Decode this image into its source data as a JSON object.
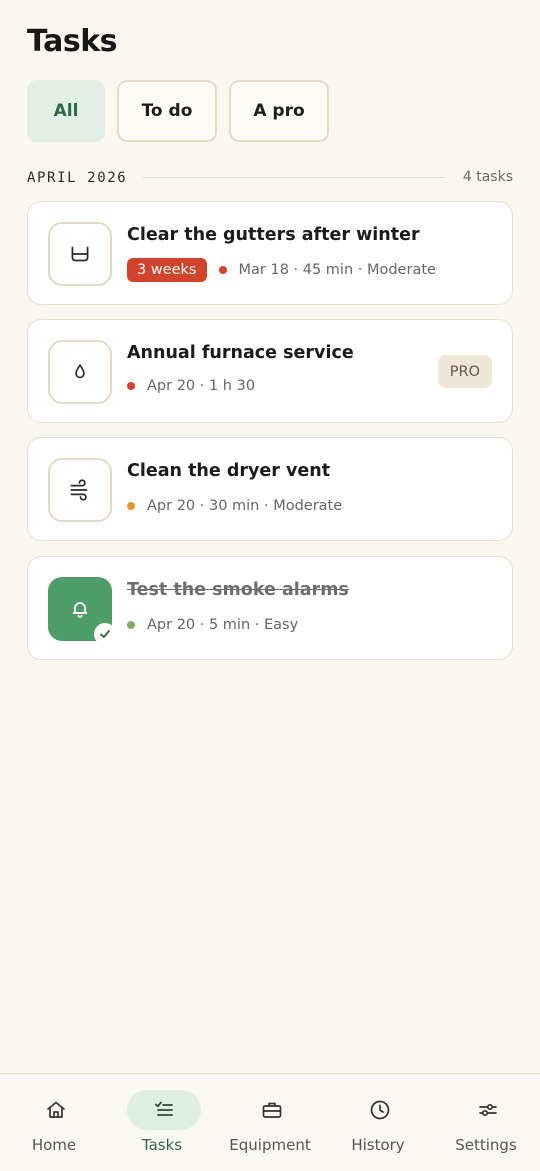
{
  "header": {
    "title": "Tasks"
  },
  "filters": [
    {
      "label": "All",
      "active": true
    },
    {
      "label": "To do",
      "active": false
    },
    {
      "label": "A pro",
      "active": false
    }
  ],
  "section": {
    "month": "APRIL 2026",
    "count": "4 tasks"
  },
  "tasks": [
    {
      "title": "Clear the gutters after winter",
      "icon": "basin-icon",
      "late_badge": "3 weeks",
      "dot_color": "#d2432b",
      "meta": "Mar 18 · 45 min · Moderate",
      "done": false
    },
    {
      "title": "Annual furnace service",
      "icon": "water-drop-icon",
      "pro_badge": "PRO",
      "dot_color": "#d2432b",
      "meta": "Apr 20 · 1 h 30",
      "done": false
    },
    {
      "title": "Clean the dryer vent",
      "icon": "wind-icon",
      "dot_color": "#e09a2a",
      "meta": "Apr 20 · 30 min · Moderate",
      "done": false
    },
    {
      "title": "Test the smoke alarms",
      "icon": "bell-icon",
      "dot_color": "#7fae63",
      "meta": "Apr 20 · 5 min · Easy",
      "done": true
    }
  ],
  "nav": [
    {
      "label": "Home",
      "icon": "home-icon",
      "active": false
    },
    {
      "label": "Tasks",
      "icon": "checklist-icon",
      "active": true
    },
    {
      "label": "Equipment",
      "icon": "toolbox-icon",
      "active": false
    },
    {
      "label": "History",
      "icon": "clock-icon",
      "active": false
    },
    {
      "label": "Settings",
      "icon": "sliders-icon",
      "active": false
    }
  ],
  "colors": {
    "accent": "#2e6a45",
    "accent_bg": "#dfeee2",
    "late": "#d2432b",
    "done": "#4e9c67",
    "background": "#faf7ef"
  }
}
